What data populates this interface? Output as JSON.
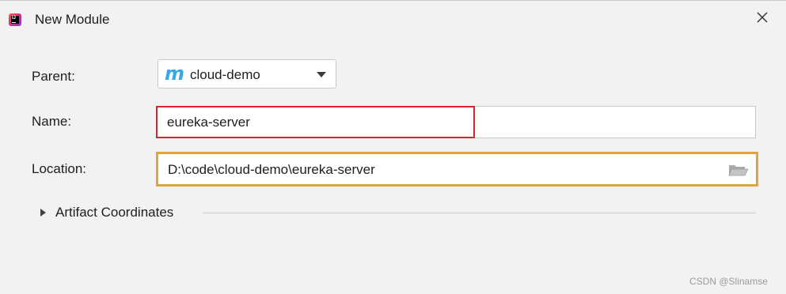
{
  "window": {
    "title": "New Module",
    "app_icon": "intellij-idea-icon",
    "close_icon": "close-icon"
  },
  "form": {
    "parent": {
      "label": "Parent:",
      "icon": "maven-m-icon",
      "icon_text": "m",
      "value": "cloud-demo"
    },
    "name": {
      "label": "Name:",
      "value": "eureka-server",
      "highlight_color": "#e0212b"
    },
    "location": {
      "label": "Location:",
      "value": "D:\\code\\cloud-demo\\eureka-server",
      "highlight_color": "#e2a53c",
      "browse_icon": "folder-icon"
    },
    "artifact_coordinates": {
      "label": "Artifact Coordinates",
      "expanded": false
    }
  },
  "watermark": "CSDN @Slinamse",
  "colors": {
    "background": "#f2f2f2",
    "maven_blue": "#36a9e1"
  }
}
